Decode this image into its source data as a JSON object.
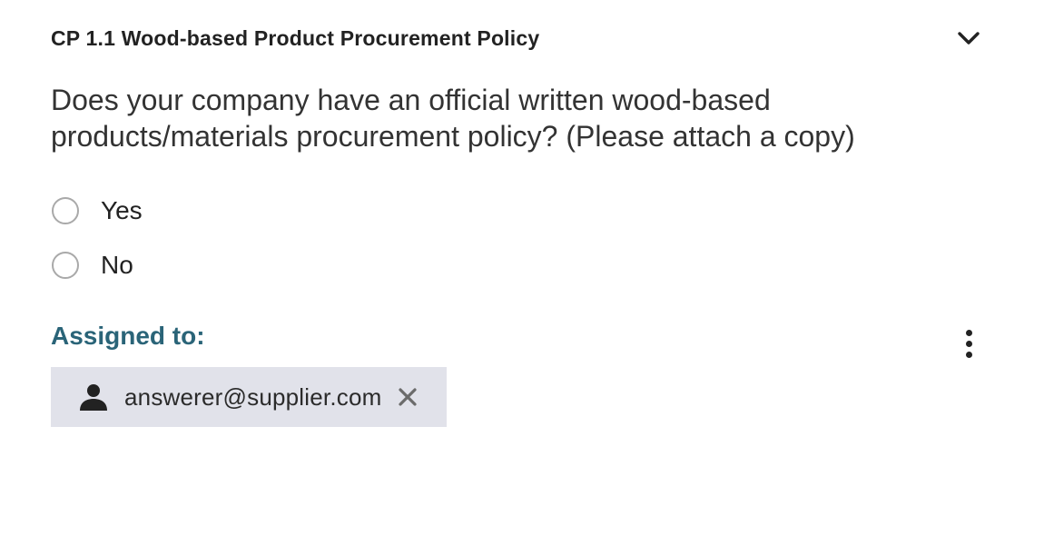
{
  "header": {
    "title": "CP 1.1 Wood-based Product Procurement Policy",
    "chevron_icon": "chevron-down-icon"
  },
  "question": {
    "text": "Does your company have an official written wood-based products/materials procurement policy? (Please attach a copy)",
    "options": [
      {
        "label": "Yes",
        "selected": false
      },
      {
        "label": "No",
        "selected": false
      }
    ]
  },
  "assignment": {
    "label": "Assigned to:",
    "more_icon": "more-vertical-icon",
    "assignee": {
      "email": "answerer@supplier.com",
      "icon": "person-icon",
      "remove_icon": "close-icon"
    }
  },
  "colors": {
    "accent": "#2a6478",
    "chip_background": "#e1e2ea",
    "radio_border": "#a9a9a9",
    "text": "#222222"
  }
}
